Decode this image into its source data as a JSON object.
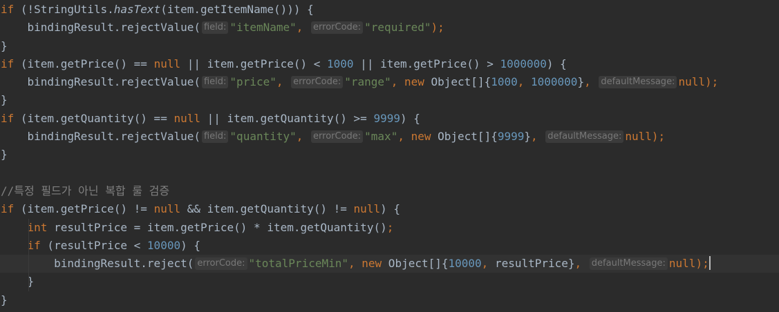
{
  "editor": {
    "colors": {
      "background": "#2b2b2b",
      "keyword": "#cc7832",
      "string": "#6a8759",
      "number": "#6897bb",
      "default": "#a9b7c6",
      "comment": "#808080",
      "hint": "#787878",
      "current_line": "#323232"
    },
    "lines": [
      [
        {
          "t": "if",
          "c": "kw"
        },
        {
          "t": " (!StringUtils."
        },
        {
          "t": "hasText",
          "c": "it"
        },
        {
          "t": "(item.getItemName())) {"
        }
      ],
      [
        {
          "t": "    bindingResult.rejectValue("
        },
        {
          "t": "field:",
          "c": "hint"
        },
        {
          "t": "\"itemName\"",
          "c": "str"
        },
        {
          "t": ", ",
          "c": "punct"
        },
        {
          "t": "errorCode:",
          "c": "hint"
        },
        {
          "t": "\"required\"",
          "c": "str"
        },
        {
          "t": ");",
          "c": "punct"
        }
      ],
      [
        {
          "t": "}"
        }
      ],
      [
        {
          "t": "if",
          "c": "kw"
        },
        {
          "t": " (item.getPrice() == "
        },
        {
          "t": "null",
          "c": "kw"
        },
        {
          "t": " || item.getPrice() < "
        },
        {
          "t": "1000",
          "c": "num"
        },
        {
          "t": " || item.getPrice() > "
        },
        {
          "t": "1000000",
          "c": "num"
        },
        {
          "t": ") {"
        }
      ],
      [
        {
          "t": "    bindingResult.rejectValue("
        },
        {
          "t": "field:",
          "c": "hint"
        },
        {
          "t": "\"price\"",
          "c": "str"
        },
        {
          "t": ", ",
          "c": "punct"
        },
        {
          "t": "errorCode:",
          "c": "hint"
        },
        {
          "t": "\"range\"",
          "c": "str"
        },
        {
          "t": ", ",
          "c": "punct"
        },
        {
          "t": "new",
          "c": "kw"
        },
        {
          "t": " Object[]{"
        },
        {
          "t": "1000",
          "c": "num"
        },
        {
          "t": ", ",
          "c": "punct"
        },
        {
          "t": "1000000",
          "c": "num"
        },
        {
          "t": "}"
        },
        {
          "t": ", ",
          "c": "punct"
        },
        {
          "t": "defaultMessage:",
          "c": "hint"
        },
        {
          "t": "null",
          "c": "kw"
        },
        {
          "t": ");",
          "c": "punct"
        }
      ],
      [
        {
          "t": "}"
        }
      ],
      [
        {
          "t": "if",
          "c": "kw"
        },
        {
          "t": " (item.getQuantity() == "
        },
        {
          "t": "null",
          "c": "kw"
        },
        {
          "t": " || item.getQuantity() >= "
        },
        {
          "t": "9999",
          "c": "num"
        },
        {
          "t": ") {"
        }
      ],
      [
        {
          "t": "    bindingResult.rejectValue("
        },
        {
          "t": "field:",
          "c": "hint"
        },
        {
          "t": "\"quantity\"",
          "c": "str"
        },
        {
          "t": ", ",
          "c": "punct"
        },
        {
          "t": "errorCode:",
          "c": "hint"
        },
        {
          "t": "\"max\"",
          "c": "str"
        },
        {
          "t": ", ",
          "c": "punct"
        },
        {
          "t": "new",
          "c": "kw"
        },
        {
          "t": " Object[]{"
        },
        {
          "t": "9999",
          "c": "num"
        },
        {
          "t": "}"
        },
        {
          "t": ", ",
          "c": "punct"
        },
        {
          "t": "defaultMessage:",
          "c": "hint"
        },
        {
          "t": "null",
          "c": "kw"
        },
        {
          "t": ");",
          "c": "punct"
        }
      ],
      [
        {
          "t": "}"
        }
      ],
      [],
      [
        {
          "t": "//특정 필드가 아닌 복합 룰 검증",
          "c": "cm"
        }
      ],
      [
        {
          "t": "if",
          "c": "kw"
        },
        {
          "t": " (item.getPrice() != "
        },
        {
          "t": "null",
          "c": "kw"
        },
        {
          "t": " && item.getQuantity() != "
        },
        {
          "t": "null",
          "c": "kw"
        },
        {
          "t": ") {"
        }
      ],
      [
        {
          "t": "    "
        },
        {
          "t": "int",
          "c": "kw"
        },
        {
          "t": " resultPrice = item.getPrice() * item.getQuantity()"
        },
        {
          "t": ";",
          "c": "punct"
        }
      ],
      [
        {
          "t": "    "
        },
        {
          "t": "if",
          "c": "kw"
        },
        {
          "t": " (resultPrice < "
        },
        {
          "t": "10000",
          "c": "num"
        },
        {
          "t": ") {"
        }
      ],
      [
        {
          "t": "        bindingResult.reject("
        },
        {
          "t": "errorCode:",
          "c": "hint"
        },
        {
          "t": "\"totalPriceMin\"",
          "c": "str"
        },
        {
          "t": ", ",
          "c": "punct"
        },
        {
          "t": "new",
          "c": "kw"
        },
        {
          "t": " Object[]{"
        },
        {
          "t": "10000",
          "c": "num"
        },
        {
          "t": ", ",
          "c": "punct"
        },
        {
          "t": "resultPrice}"
        },
        {
          "t": ", ",
          "c": "punct"
        },
        {
          "t": "defaultMessage:",
          "c": "hint"
        },
        {
          "t": "null",
          "c": "kw"
        },
        {
          "t": ");",
          "c": "punct"
        }
      ],
      [
        {
          "t": "    }"
        }
      ],
      [
        {
          "t": "}"
        }
      ]
    ]
  }
}
